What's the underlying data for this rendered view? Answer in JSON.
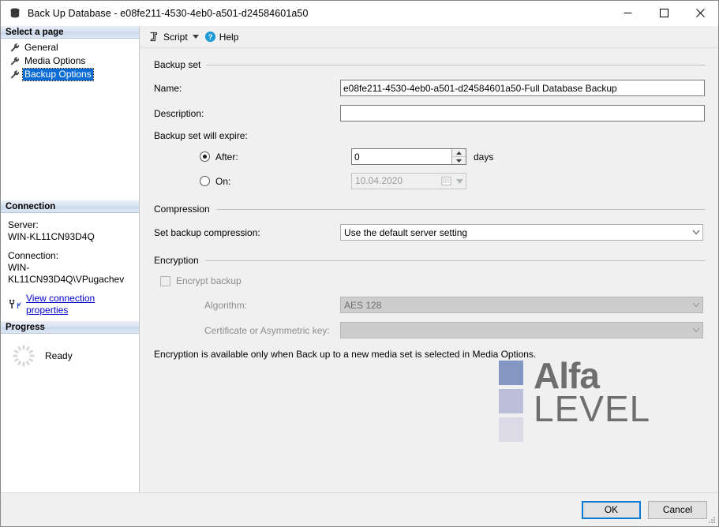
{
  "window": {
    "title": "Back Up Database - e08fe211-4530-4eb0-a501-d24584601a50",
    "icon": "database-icon",
    "minimize_label": "Minimize",
    "maximize_label": "Maximize",
    "close_label": "Close"
  },
  "sidebar": {
    "select_page_header": "Select a page",
    "pages": [
      {
        "label": "General",
        "selected": false
      },
      {
        "label": "Media Options",
        "selected": false
      },
      {
        "label": "Backup Options",
        "selected": true
      }
    ],
    "connection": {
      "header": "Connection",
      "server_label": "Server:",
      "server_value": "WIN-KL11CN93D4Q",
      "connection_label": "Connection:",
      "connection_value": "WIN-KL11CN93D4Q\\VPugachev",
      "link_text": "View connection properties"
    },
    "progress": {
      "header": "Progress",
      "status": "Ready"
    }
  },
  "toolbar": {
    "script_label": "Script",
    "help_label": "Help"
  },
  "main": {
    "backup_set": {
      "group_title": "Backup set",
      "name_label": "Name:",
      "name_value": "e08fe211-4530-4eb0-a501-d24584601a50-Full Database Backup",
      "description_label": "Description:",
      "description_value": "",
      "expire_label": "Backup set will expire:",
      "after_label": "After:",
      "after_value": "0",
      "after_selected": true,
      "days_label": "days",
      "on_label": "On:",
      "on_value": "10.04.2020",
      "on_selected": false
    },
    "compression": {
      "group_title": "Compression",
      "label": "Set backup compression:",
      "value": "Use the default server setting"
    },
    "encryption": {
      "group_title": "Encryption",
      "encrypt_backup_label": "Encrypt backup",
      "encrypt_backup_checked": false,
      "algorithm_label": "Algorithm:",
      "algorithm_value": "AES 128",
      "certificate_label": "Certificate or Asymmetric key:",
      "certificate_value": "",
      "note": "Encryption is available only when Back up to a new media set is selected in Media Options."
    }
  },
  "watermark": {
    "brand_top": "Alfa",
    "brand_bottom": "LEVEL",
    "square_colors": [
      "#8496c2",
      "#bbbfd9",
      "#dbdae6"
    ],
    "text_color": "#6e6e6e"
  },
  "footer": {
    "ok_label": "OK",
    "cancel_label": "Cancel"
  },
  "colors": {
    "selection_blue": "#0a6cd4",
    "link_blue": "#0000cc",
    "help_icon_blue": "#1e9bd7",
    "default_button_border": "#0a7ad4"
  }
}
